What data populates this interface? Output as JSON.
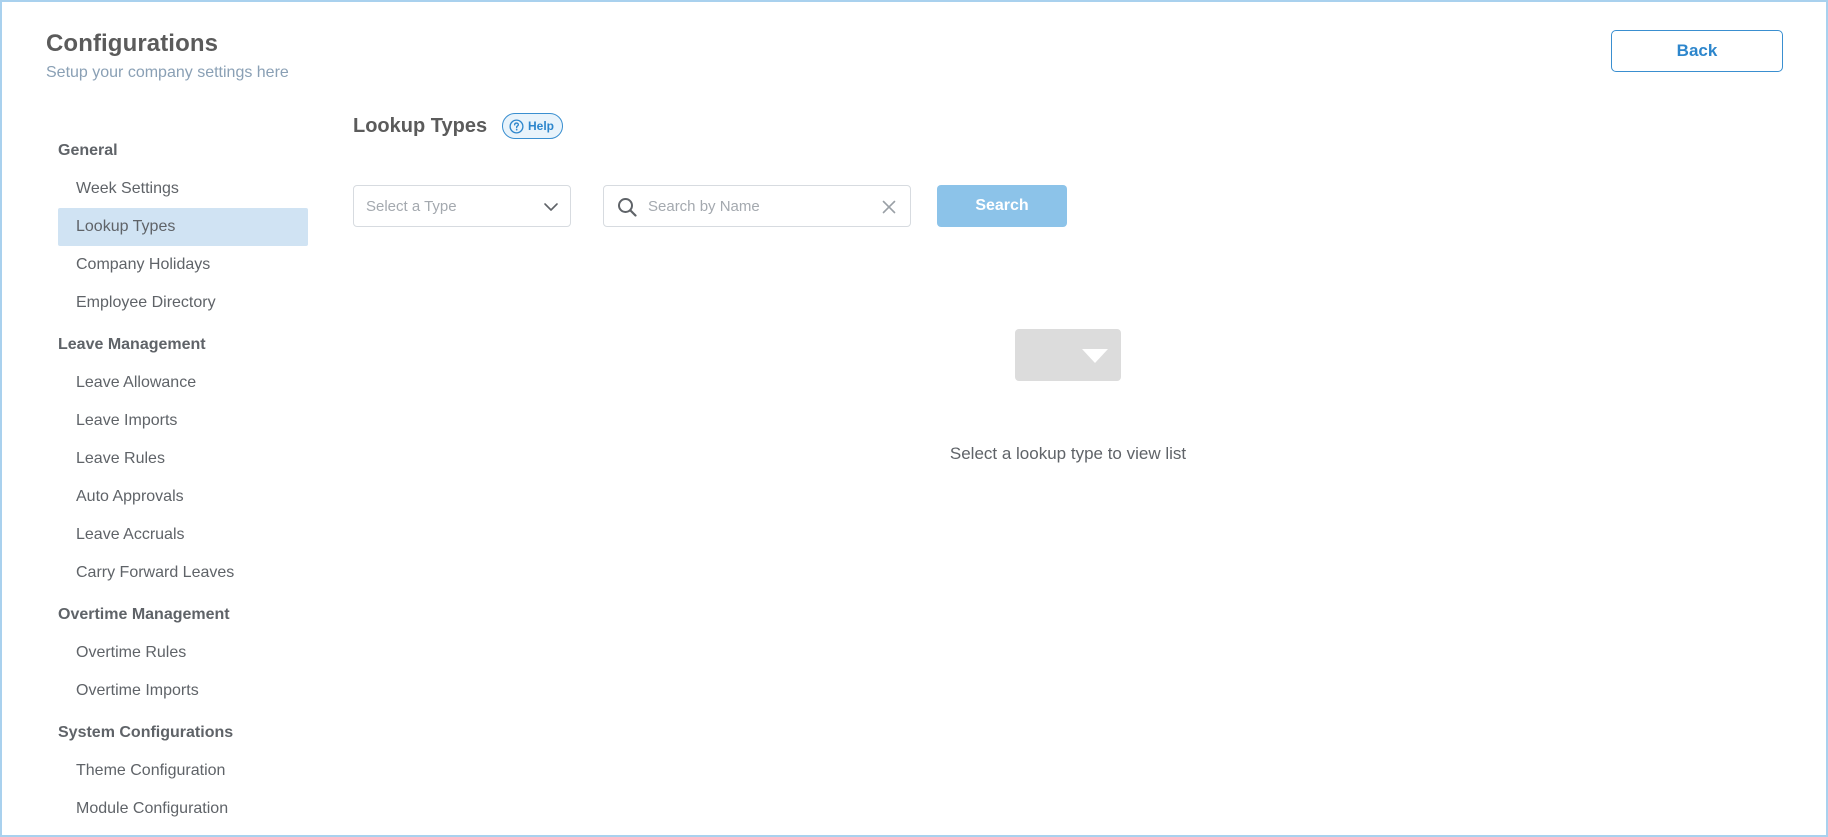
{
  "header": {
    "title": "Configurations",
    "subtitle": "Setup your company settings here",
    "back_label": "Back"
  },
  "sidebar": {
    "sections": [
      {
        "title": "General",
        "items": [
          "Week Settings",
          "Lookup Types",
          "Company Holidays",
          "Employee Directory"
        ]
      },
      {
        "title": "Leave Management",
        "items": [
          "Leave Allowance",
          "Leave Imports",
          "Leave Rules",
          "Auto Approvals",
          "Leave Accruals",
          "Carry Forward Leaves"
        ]
      },
      {
        "title": "Overtime Management",
        "items": [
          "Overtime Rules",
          "Overtime Imports"
        ]
      },
      {
        "title": "System Configurations",
        "items": [
          "Theme Configuration",
          "Module Configuration"
        ]
      }
    ],
    "active_item": "Lookup Types"
  },
  "main": {
    "title": "Lookup Types",
    "help_label": "Help",
    "type_select_placeholder": "Select a Type",
    "search_placeholder": "Search by Name",
    "search_value": "",
    "search_button_label": "Search",
    "empty_message": "Select a lookup type to view list"
  },
  "icons": {
    "help": "question-circle-icon",
    "dropdown": "chevron-down-icon",
    "search": "magnifier-icon",
    "clear": "close-icon",
    "empty": "empty-dropdown-icon"
  },
  "colors": {
    "accent": "#2d86cc",
    "active_nav_bg": "#d0e3f3",
    "search_button_bg": "#8cc3e9",
    "frame_border": "#a9d1ee"
  }
}
